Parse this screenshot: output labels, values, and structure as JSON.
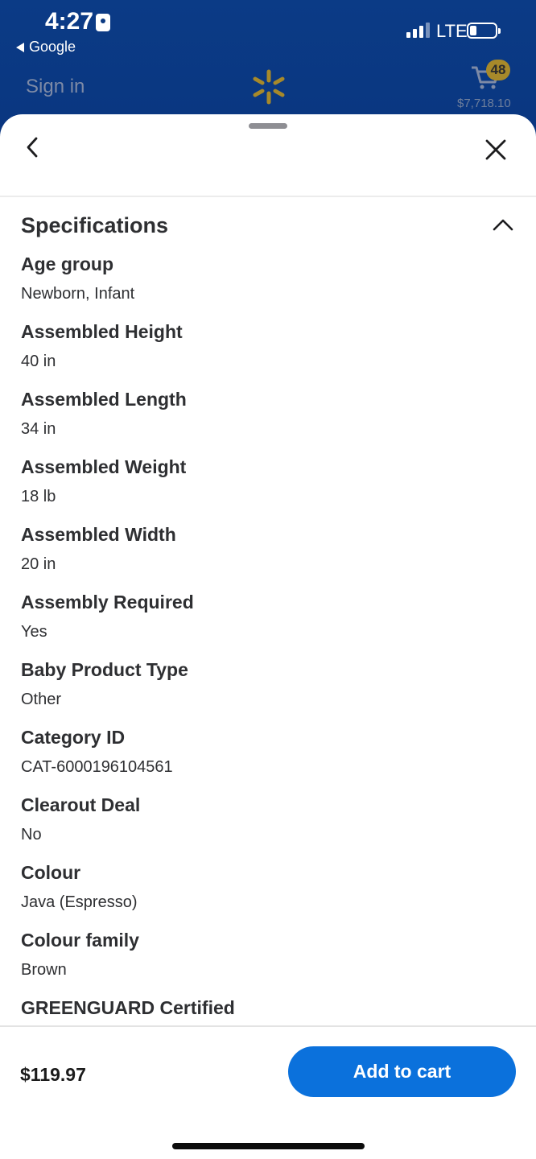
{
  "status_bar": {
    "time": "4:27",
    "back_app": "Google",
    "network": "LTE"
  },
  "app_header": {
    "sign_in": "Sign in",
    "cart_count": "48",
    "cart_total": "$7,718.10"
  },
  "sheet": {
    "section_title": "Specifications",
    "specs": [
      {
        "label": "Age group",
        "value": "Newborn, Infant"
      },
      {
        "label": "Assembled Height",
        "value": "40 in"
      },
      {
        "label": "Assembled Length",
        "value": "34 in"
      },
      {
        "label": "Assembled Weight",
        "value": "18 lb"
      },
      {
        "label": "Assembled Width",
        "value": "20 in"
      },
      {
        "label": "Assembly Required",
        "value": "Yes"
      },
      {
        "label": "Baby Product Type",
        "value": "Other"
      },
      {
        "label": "Category ID",
        "value": "CAT-6000196104561"
      },
      {
        "label": "Clearout Deal",
        "value": "No"
      },
      {
        "label": "Colour",
        "value": "Java (Espresso)"
      },
      {
        "label": "Colour family",
        "value": "Brown"
      },
      {
        "label": "GREENGUARD Certified",
        "value": ""
      }
    ]
  },
  "footer": {
    "price": "$119.97",
    "add_to_cart": "Add to cart"
  },
  "colors": {
    "header_bg": "#0b3a82",
    "button_blue": "#0b71dc",
    "spark_yellow": "#a7892a"
  }
}
